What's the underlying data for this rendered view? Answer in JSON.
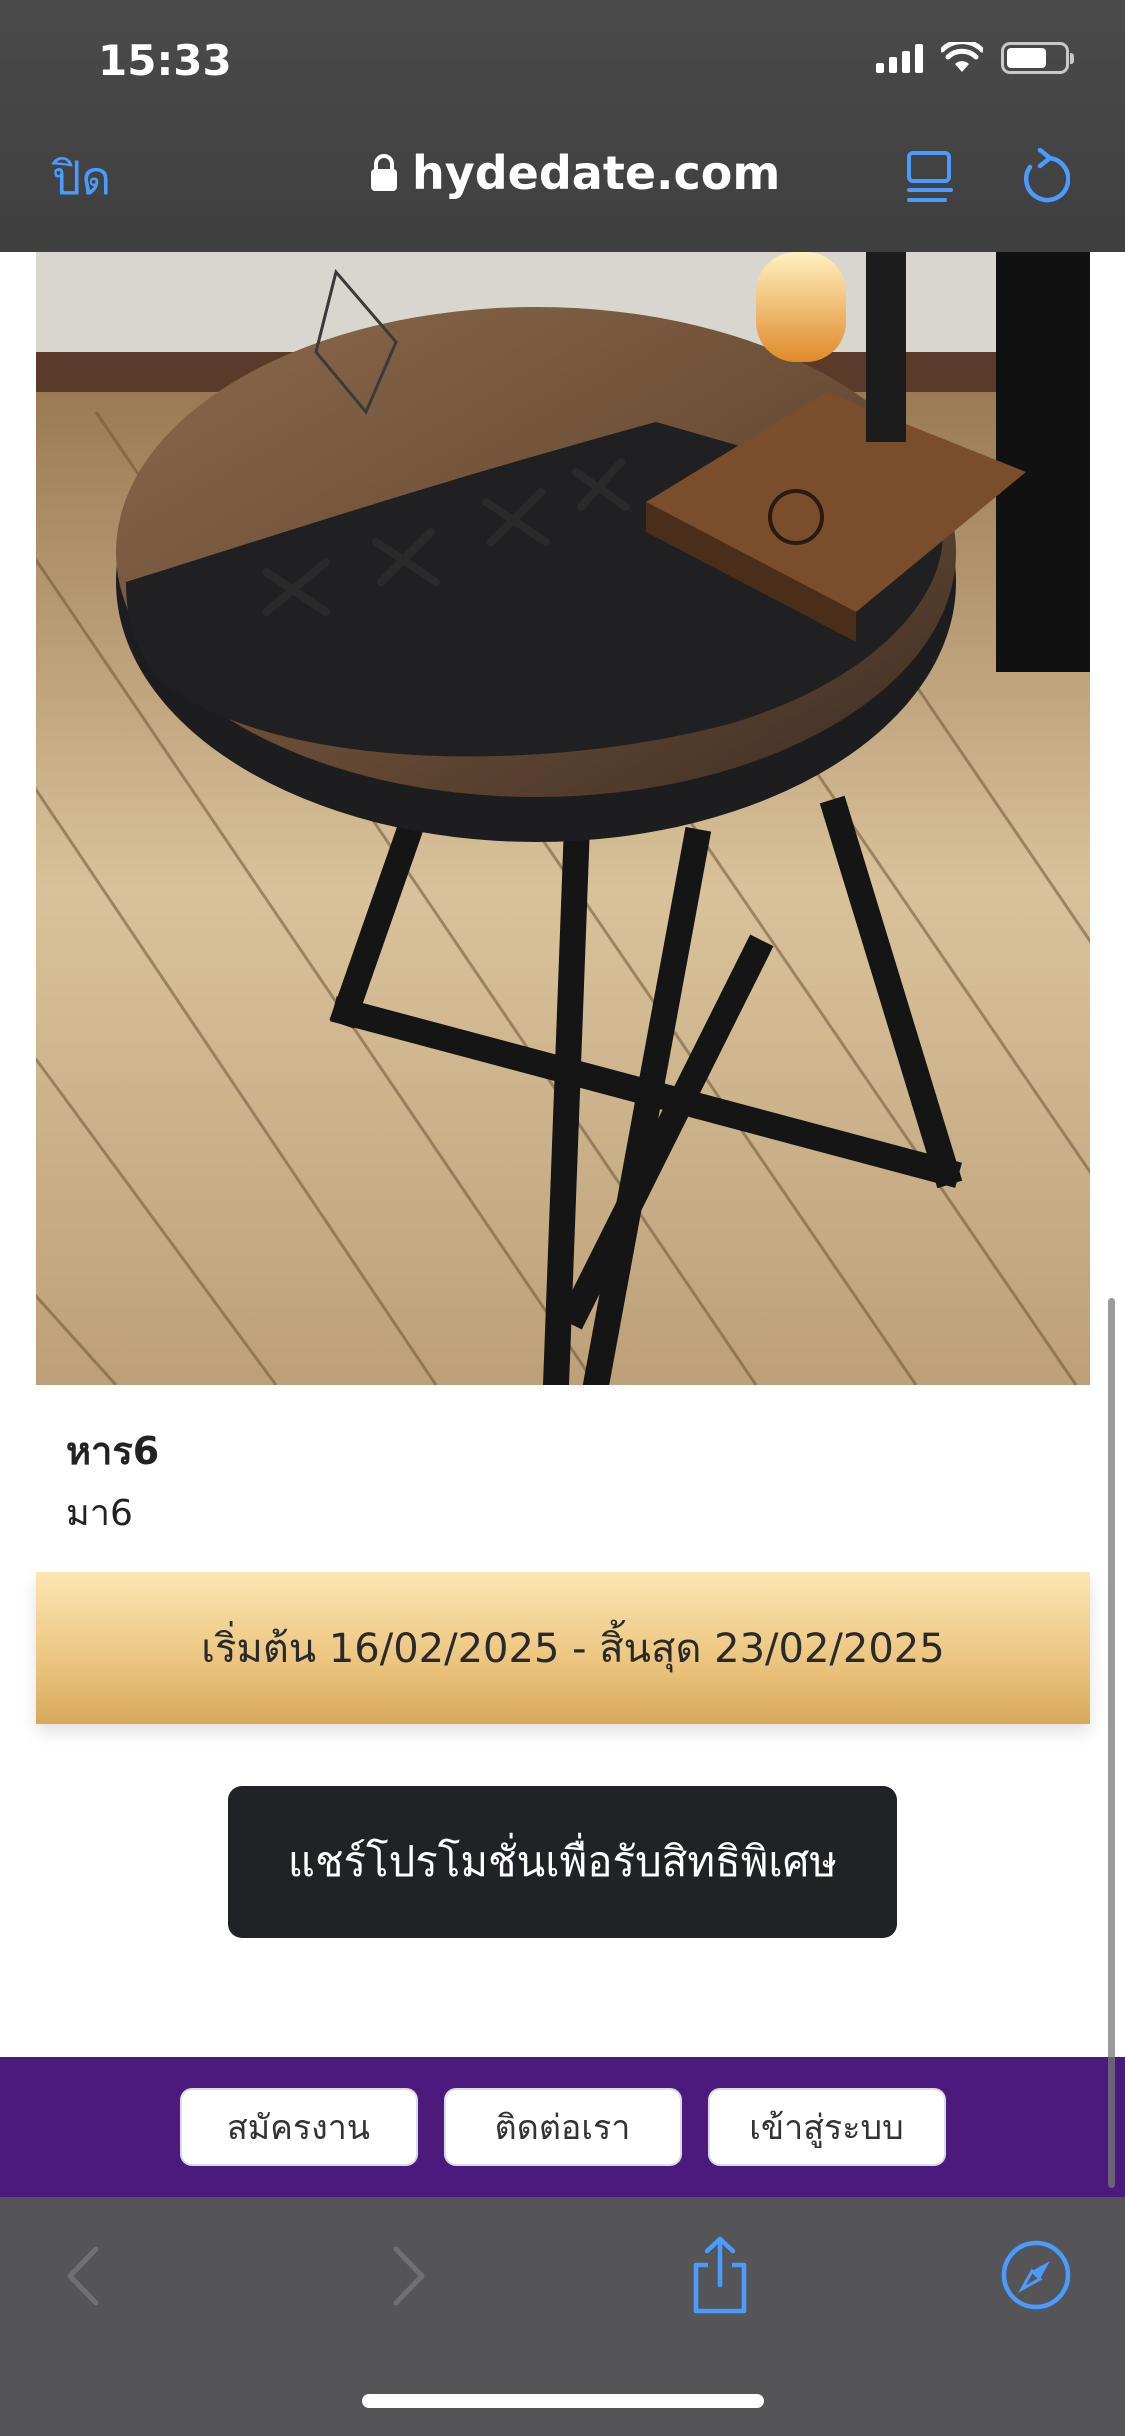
{
  "status_bar": {
    "time": "15:33",
    "icons": [
      "cellular-signal-icon",
      "wifi-icon",
      "battery-icon"
    ]
  },
  "browser": {
    "close_label": "ปิด",
    "url": "hydedate.com",
    "icons": [
      "lock-icon",
      "reader-view-icon",
      "reload-icon"
    ],
    "accent_color": "#4a9bff"
  },
  "product": {
    "image_alt": "round wooden side table with black metal legs",
    "name": "หาร6",
    "subtitle": "มา6"
  },
  "promo": {
    "date_range": "เริ่มต้น 16/02/2025 - สิ้นสุด 23/02/2025",
    "share_label": "แชร์โปรโมชั่นเพื่อรับสิทธิพิเศษ"
  },
  "footer_nav": {
    "background_color": "#4b1a7c",
    "items": [
      {
        "label": "สมัครงาน"
      },
      {
        "label": "ติดต่อเรา"
      },
      {
        "label": "เข้าสู่ระบบ"
      }
    ]
  },
  "toolbar": {
    "icons": [
      "back-icon",
      "forward-icon",
      "share-icon",
      "compass-icon"
    ]
  }
}
